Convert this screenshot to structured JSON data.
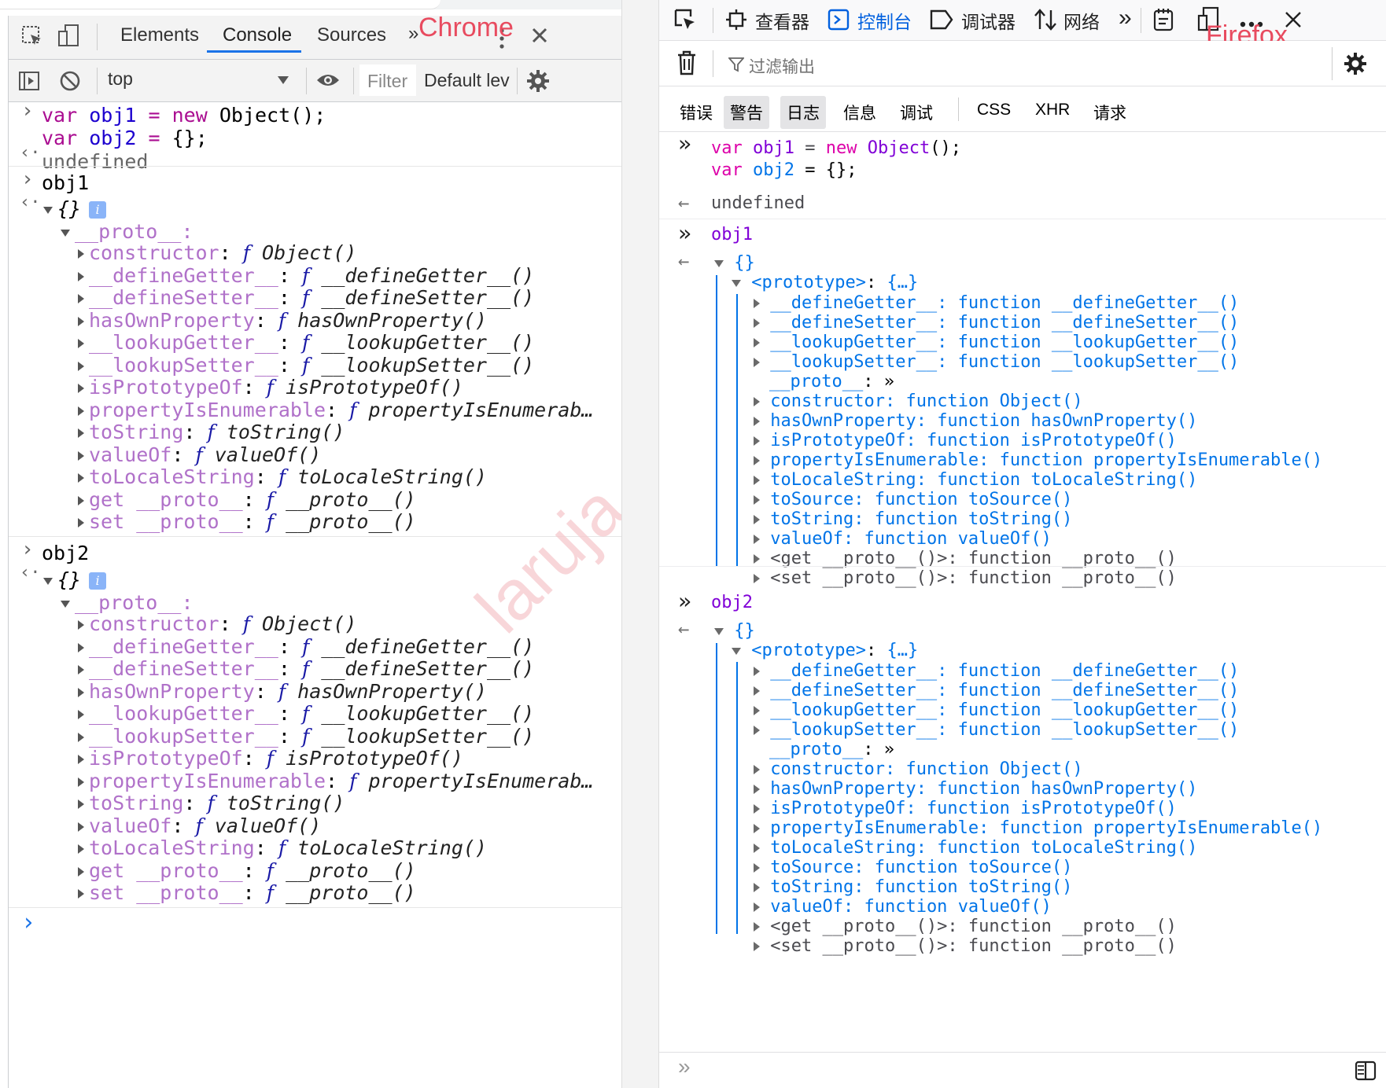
{
  "labels": {
    "chrome": "Chrome",
    "firefox": "Firefox"
  },
  "watermark": "laruja",
  "chrome": {
    "tabs": [
      "Elements",
      "Console",
      "Sources"
    ],
    "tab_more": "»",
    "context": "top",
    "filter_placeholder": "Filter",
    "levels": "Default lev",
    "input1": [
      "var",
      "obj1",
      "=",
      "new",
      "Object();"
    ],
    "input2": [
      "var",
      "obj2",
      "=",
      "{};"
    ],
    "result": "undefined",
    "obj1": "obj1",
    "obj2": "obj2",
    "obj_summary": "{}",
    "info": "i",
    "proto": "__proto__:",
    "props": [
      [
        "constructor",
        "Object()"
      ],
      [
        "__defineGetter__",
        "__defineGetter__()"
      ],
      [
        "__defineSetter__",
        "__defineSetter__()"
      ],
      [
        "hasOwnProperty",
        "hasOwnProperty()"
      ],
      [
        "__lookupGetter__",
        "__lookupGetter__()"
      ],
      [
        "__lookupSetter__",
        "__lookupSetter__()"
      ],
      [
        "isPrototypeOf",
        "isPrototypeOf()"
      ],
      [
        "propertyIsEnumerable",
        "propertyIsEnumerab…"
      ],
      [
        "toString",
        "toString()"
      ],
      [
        "valueOf",
        "valueOf()"
      ],
      [
        "toLocaleString",
        "toLocaleString()"
      ],
      [
        "get __proto__",
        "__proto__()"
      ],
      [
        "set __proto__",
        "__proto__()"
      ]
    ],
    "f": "f",
    "prompt": "›"
  },
  "firefox": {
    "tabs": [
      "查看器",
      "控制台",
      "调试器",
      "网络"
    ],
    "filter_placeholder": "过滤输出",
    "filters": [
      "错误",
      "警告",
      "日志",
      "信息",
      "调试",
      "CSS",
      "XHR",
      "请求"
    ],
    "input1": [
      "var",
      "obj1",
      "=",
      "new",
      "Object",
      "();"
    ],
    "input2": [
      "var",
      "obj2",
      "=",
      "{};"
    ],
    "result": "undefined",
    "obj1": "obj1",
    "obj2": "obj2",
    "obj_summary": "{}",
    "prototype": "<prototype>",
    "prototype_summary": "{…}",
    "props_a": [
      [
        "__defineGetter__",
        "__defineGetter__()"
      ],
      [
        "__defineSetter__",
        "__defineSetter__()"
      ],
      [
        "__lookupGetter__",
        "__lookupGetter__()"
      ],
      [
        "__lookupSetter__",
        "__lookupSetter__()"
      ]
    ],
    "proto_row": "__proto__",
    "proto_icon": "»",
    "props_b": [
      [
        "constructor",
        "Object()"
      ],
      [
        "hasOwnProperty",
        "hasOwnProperty()"
      ],
      [
        "isPrototypeOf",
        "isPrototypeOf()"
      ],
      [
        "propertyIsEnumerable",
        "propertyIsEnumerable()"
      ],
      [
        "toLocaleString",
        "toLocaleString()"
      ],
      [
        "toSource",
        "toSource()"
      ],
      [
        "toString",
        "toString()"
      ],
      [
        "valueOf",
        "valueOf()"
      ]
    ],
    "props_c": [
      [
        "<get __proto__()>",
        "__proto__()"
      ],
      [
        "<set __proto__()>",
        "__proto__()"
      ]
    ],
    "function": "function",
    "input_prompt": "»",
    "output_arrow": "←"
  }
}
